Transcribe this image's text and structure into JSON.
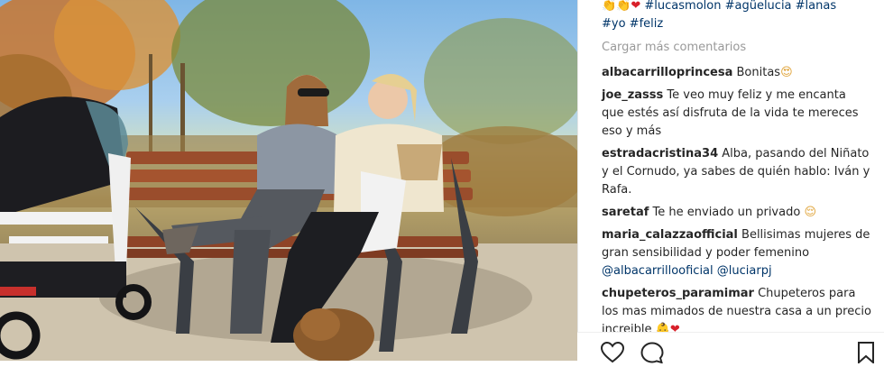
{
  "post": {
    "caption_emojis": "👏👏",
    "caption_heart": "❤",
    "caption_line1": " #lucasmolon #agüelucia #lanas",
    "caption_line2": "#yo #feliz"
  },
  "load_more_label": "Cargar más comentarios",
  "comments": [
    {
      "user": "albacarrilloprincesa",
      "text": "Bonitas",
      "emoji": "😍"
    },
    {
      "user": "joe_zasss",
      "text": "Te veo muy feliz y me encanta que estés así disfruta de la vida te mereces eso y más"
    },
    {
      "user": "estradacristina34",
      "text": "Alba, pasando del Niñato y el Cornudo, ya sabes de quién hablo: Iván y Rafa."
    },
    {
      "user": "saretaf",
      "text": "Te he enviado un privado",
      "emoji": "😌"
    },
    {
      "user": "maria_calazzaofficial",
      "text": "Bellisimas mujeres de gran sensibilidad y poder femenino",
      "mention1": "@albacarrillooficial",
      "mention2": "@luciarpj"
    },
    {
      "user": "chupeteros_paramimar",
      "text": "Chupeteros para los mas mimados de nuestra casa a un precio increible",
      "emoji": "👶",
      "heart": "❤"
    }
  ],
  "actions": {
    "like_icon": "heart-outline-icon",
    "comment_icon": "speech-bubble-icon",
    "save_icon": "bookmark-icon"
  }
}
